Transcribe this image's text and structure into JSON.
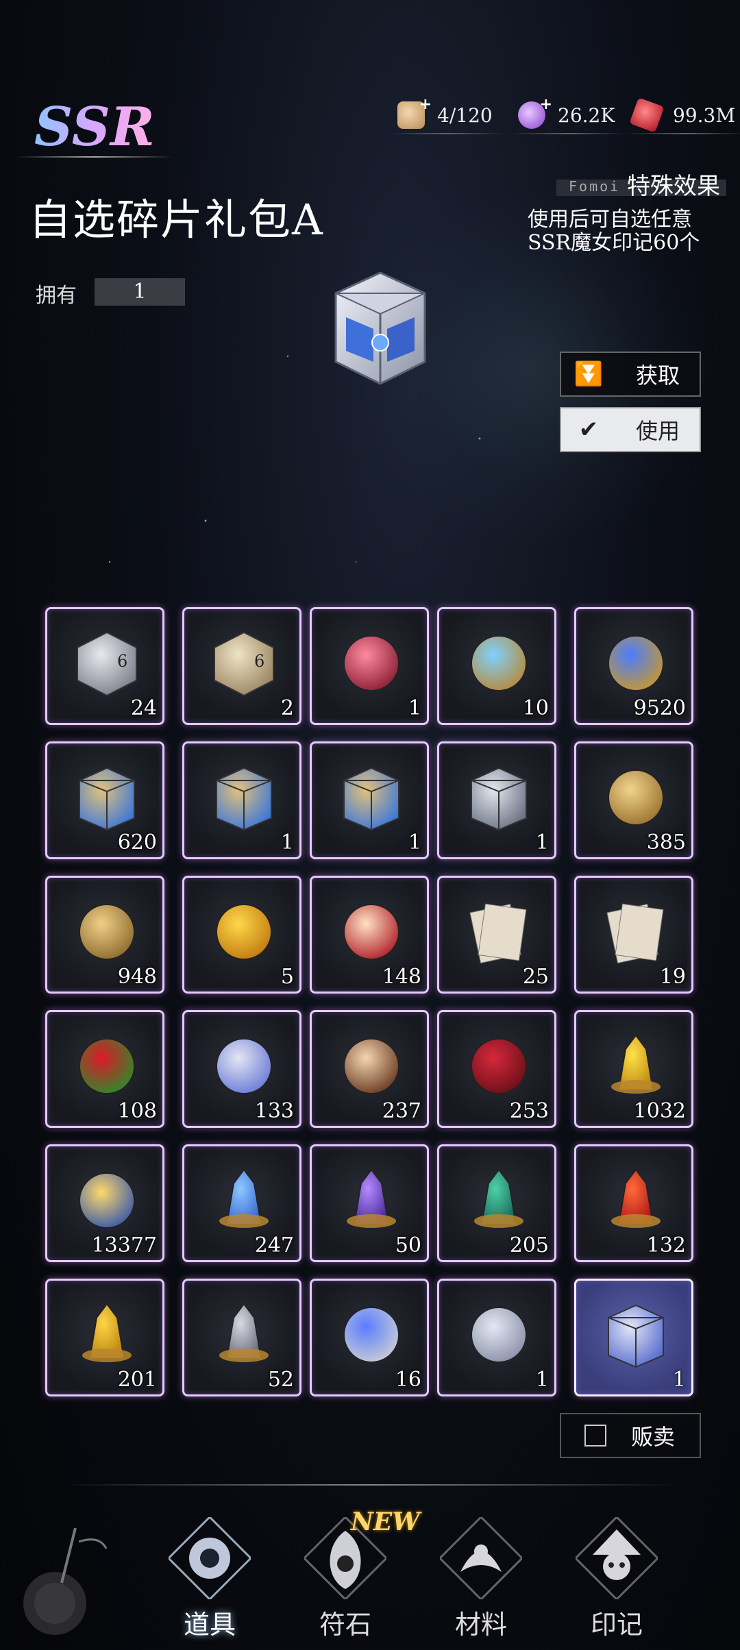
{
  "header": {
    "rarity": "SSR",
    "resources": [
      {
        "name": "stamina",
        "icon": "bread-icon",
        "value": "4/120",
        "has_plus": true
      },
      {
        "name": "crystal",
        "icon": "purple-crystal-icon",
        "value": "26.2K",
        "has_plus": true
      },
      {
        "name": "gem",
        "icon": "red-gem-icon",
        "value": "99.3M",
        "has_plus": false
      }
    ]
  },
  "item": {
    "title": "自选碎片礼包A",
    "own_label": "拥有",
    "own_count": "1"
  },
  "special": {
    "subtitle": "Fomoi",
    "title": "特殊效果",
    "description": "使用后可自选任意SSR魔女印记60个"
  },
  "actions": {
    "get_label": "获取",
    "use_label": "使用",
    "sell_label": "贩卖"
  },
  "inventory": [
    {
      "icon": "silver-dice-icon",
      "qty": "24"
    },
    {
      "icon": "gold-dice-icon",
      "qty": "2"
    },
    {
      "icon": "ss-emblem-icon",
      "qty": "1"
    },
    {
      "icon": "blue-orb-icon",
      "qty": "10"
    },
    {
      "icon": "blue-gold-orb-icon",
      "qty": "9520"
    },
    {
      "icon": "gold-chest-icon",
      "qty": "620"
    },
    {
      "icon": "gold-chest-icon",
      "qty": "1"
    },
    {
      "icon": "gold-chest-icon",
      "qty": "1"
    },
    {
      "icon": "silver-chest-icon",
      "qty": "1"
    },
    {
      "icon": "gold-crown-shield-icon",
      "qty": "385"
    },
    {
      "icon": "gold-crest-icon",
      "qty": "948"
    },
    {
      "icon": "golden-ticket-icon",
      "qty": "5"
    },
    {
      "icon": "cupcake-icon",
      "qty": "148"
    },
    {
      "icon": "scroll-pages-icon",
      "qty": "25"
    },
    {
      "icon": "scroll-pages-icon",
      "qty": "19"
    },
    {
      "icon": "red-rose-icon",
      "qty": "108"
    },
    {
      "icon": "tiara-icon",
      "qty": "133"
    },
    {
      "icon": "cake-icon",
      "qty": "237"
    },
    {
      "icon": "gift-box-icon",
      "qty": "253"
    },
    {
      "icon": "gold-crystal-crown-icon",
      "qty": "1032"
    },
    {
      "icon": "glowing-orb-icon",
      "qty": "13377"
    },
    {
      "icon": "blue-crystal-icon",
      "qty": "247"
    },
    {
      "icon": "purple-crystal-icon",
      "qty": "50"
    },
    {
      "icon": "green-crystal-icon",
      "qty": "205"
    },
    {
      "icon": "red-crystal-icon",
      "qty": "132"
    },
    {
      "icon": "yellow-crystal-icon",
      "qty": "201"
    },
    {
      "icon": "silver-crystal-icon",
      "qty": "52"
    },
    {
      "icon": "spiked-blue-orb-icon",
      "qty": "16"
    },
    {
      "icon": "mirror-teacup-icon",
      "qty": "1"
    },
    {
      "icon": "silver-blue-chest-icon",
      "qty": "1",
      "selected": true
    }
  ],
  "tabs": [
    {
      "label": "道具",
      "icon": "props-emblem-icon",
      "active": true
    },
    {
      "label": "符石",
      "icon": "runestone-emblem-icon",
      "badge": "NEW"
    },
    {
      "label": "材料",
      "icon": "materials-emblem-icon"
    },
    {
      "label": "印记",
      "icon": "mark-emblem-icon"
    }
  ]
}
